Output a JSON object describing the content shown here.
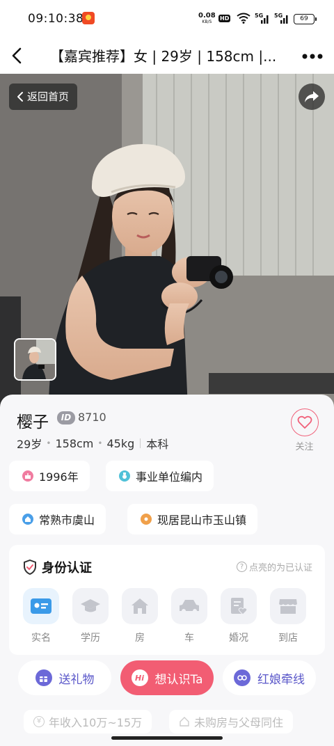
{
  "status_bar": {
    "time": "09:10:38",
    "net_speed": "0.08",
    "net_unit": "KB/S",
    "hd": "HD",
    "sim1": "5G",
    "sim2": "5G",
    "battery": "69"
  },
  "nav": {
    "title": "【嘉宾推荐】女 | 29岁 | 158cm |..."
  },
  "photo": {
    "back_home_label": "返回首页"
  },
  "profile": {
    "name": "樱子",
    "id_label": "ID",
    "id_number": "8710",
    "age": "29岁",
    "height": "158cm",
    "weight": "45kg",
    "education": "本科",
    "follow_label": "关注"
  },
  "tags": {
    "birth_year": "1996年",
    "job": "事业单位编内",
    "hometown": "常熟市虞山",
    "residence": "现居昆山市玉山镇"
  },
  "identity": {
    "title": "身份认证",
    "hint": "点亮的为已认证",
    "items": [
      {
        "label": "实名",
        "icon": "id-card-icon",
        "verified": true
      },
      {
        "label": "学历",
        "icon": "graduation-cap-icon",
        "verified": false
      },
      {
        "label": "房",
        "icon": "house-icon",
        "verified": false
      },
      {
        "label": "车",
        "icon": "car-icon",
        "verified": false
      },
      {
        "label": "婚况",
        "icon": "marriage-doc-icon",
        "verified": false
      },
      {
        "label": "到店",
        "icon": "store-icon",
        "verified": false
      }
    ]
  },
  "actions": {
    "gift": "送礼物",
    "hi": "Hi",
    "meet": "想认识Ta",
    "matchmaker": "红娘牵线"
  },
  "extra_tags": {
    "income": "年收入10万~15万",
    "housing": "未购房与父母同住"
  },
  "colors": {
    "accent_pink": "#f25d73",
    "accent_purple": "#6c69d8",
    "verified_blue": "#3a9ae8"
  }
}
